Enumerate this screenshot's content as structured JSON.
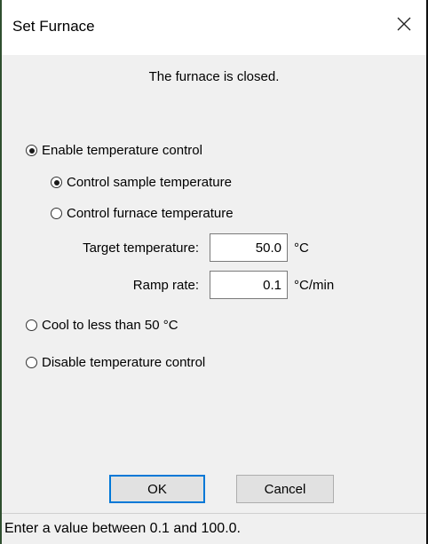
{
  "window": {
    "title": "Set Furnace",
    "close_icon": "close-icon"
  },
  "dialog": {
    "status_message": "The furnace is closed.",
    "enable_control": {
      "label": "Enable temperature control",
      "checked": true
    },
    "control_sample": {
      "label": "Control sample temperature",
      "checked": true
    },
    "control_furnace": {
      "label": "Control furnace temperature",
      "checked": false
    },
    "target_temperature": {
      "label": "Target temperature:",
      "value": "50.0",
      "unit": "°C"
    },
    "ramp_rate": {
      "label": "Ramp rate:",
      "value": "0.1",
      "unit": "°C/min"
    },
    "cool_down": {
      "label": "Cool to less than 50 °C",
      "checked": false
    },
    "disable_control": {
      "label": "Disable temperature control",
      "checked": false
    }
  },
  "buttons": {
    "ok_label": "OK",
    "cancel_label": "Cancel"
  },
  "statusbar": {
    "text": "Enter a value between 0.1 and 100.0."
  },
  "colors": {
    "default_button_border": "#0078d7",
    "dialog_background": "#f0f0f0"
  }
}
